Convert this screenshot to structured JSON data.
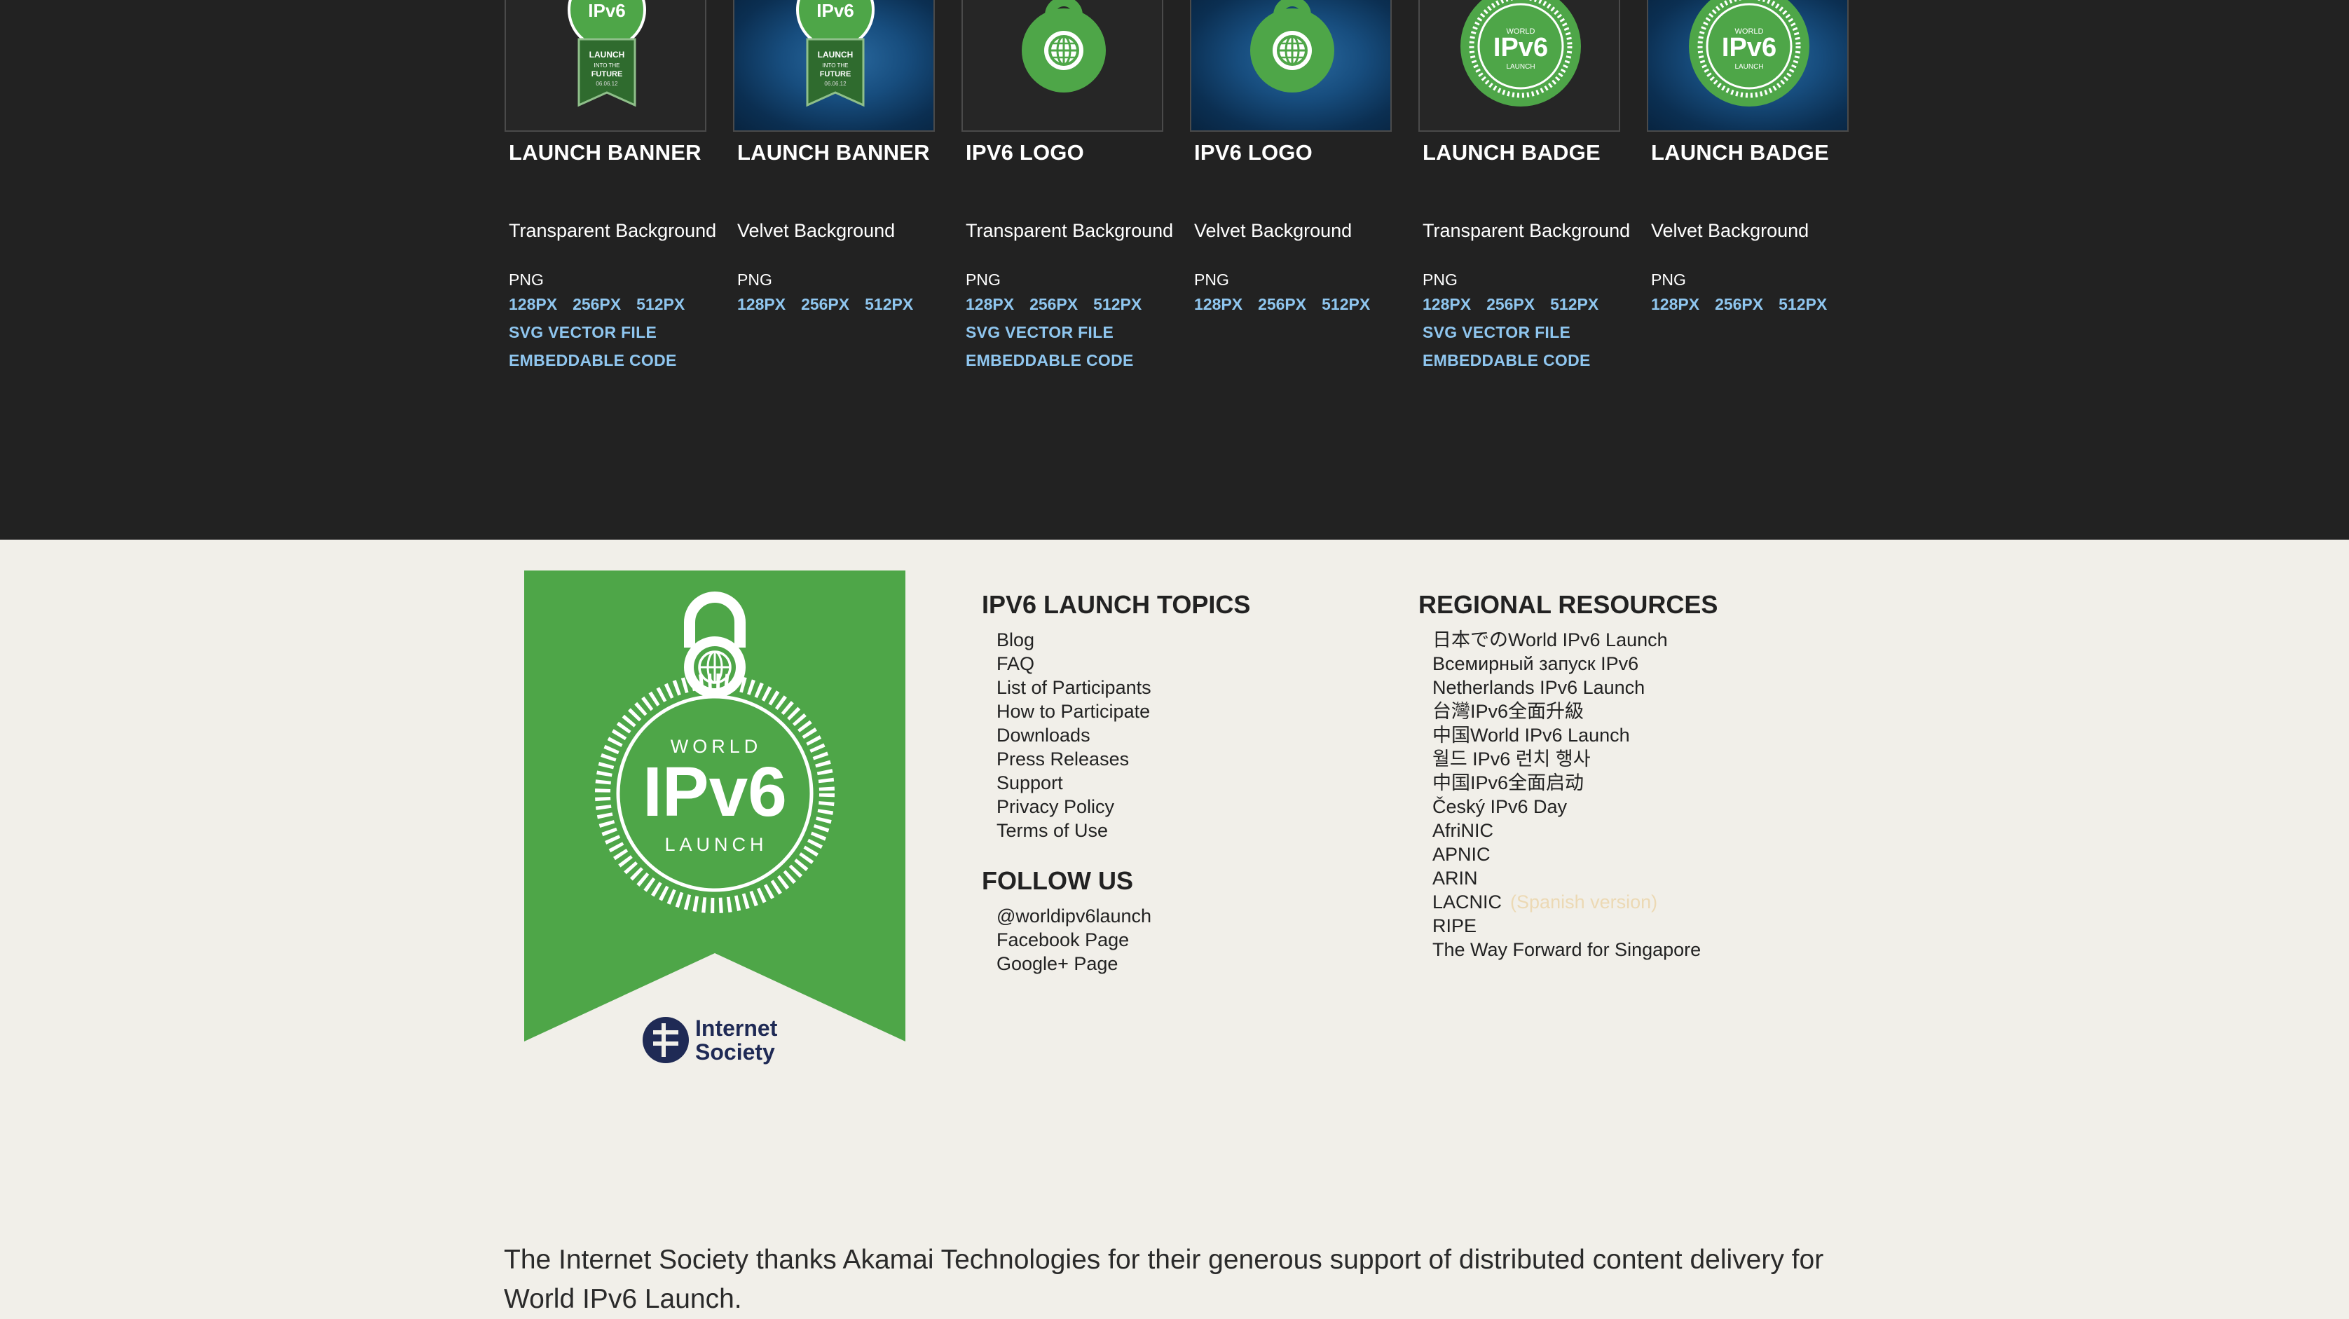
{
  "cards": [
    {
      "title": "LAUNCH BANNER",
      "background": "Transparent Background",
      "format": "PNG",
      "sizes": [
        "128PX",
        "256PX",
        "512PX"
      ],
      "svg_label": "SVG VECTOR FILE",
      "embed_label": "EMBEDDABLE CODE",
      "icon": "launch-banner-icon",
      "thumb_style": "transparent"
    },
    {
      "title": "LAUNCH BANNER",
      "background": "Velvet Background",
      "format": "PNG",
      "sizes": [
        "128PX",
        "256PX",
        "512PX"
      ],
      "icon": "launch-banner-icon",
      "thumb_style": "velvet"
    },
    {
      "title": "IPV6 LOGO",
      "background": "Transparent Background",
      "format": "PNG",
      "sizes": [
        "128PX",
        "256PX",
        "512PX"
      ],
      "svg_label": "SVG VECTOR FILE",
      "embed_label": "EMBEDDABLE CODE",
      "icon": "ipv6-logo-icon",
      "thumb_style": "transparent"
    },
    {
      "title": "IPV6 LOGO",
      "background": "Velvet Background",
      "format": "PNG",
      "sizes": [
        "128PX",
        "256PX",
        "512PX"
      ],
      "icon": "ipv6-logo-icon",
      "thumb_style": "velvet"
    },
    {
      "title": "LAUNCH BADGE",
      "background": "Transparent Background",
      "format": "PNG",
      "sizes": [
        "128PX",
        "256PX",
        "512PX"
      ],
      "svg_label": "SVG VECTOR FILE",
      "embed_label": "EMBEDDABLE CODE",
      "icon": "launch-badge-icon",
      "thumb_style": "transparent"
    },
    {
      "title": "LAUNCH BADGE",
      "background": "Velvet Background",
      "format": "PNG",
      "sizes": [
        "128PX",
        "256PX",
        "512PX"
      ],
      "icon": "launch-badge-icon",
      "thumb_style": "velvet"
    }
  ],
  "thumb_text": {
    "badge_top": "IPv6",
    "banner_line1": "LAUNCH",
    "banner_line2": "INTO THE",
    "banner_line3": "FUTURE",
    "banner_line4": "06.06.12",
    "badge_world": "WORLD",
    "badge_ipv6": "IPv6",
    "badge_launch": "LAUNCH"
  },
  "footer_logo": {
    "world": "WORLD",
    "ipv6": "IPv6",
    "launch": "LAUNCH",
    "org_line1": "Internet",
    "org_line2": "Society"
  },
  "topics": {
    "title": "IPV6 LAUNCH TOPICS",
    "items": [
      "Blog",
      "FAQ",
      "List of Participants",
      "How to Participate",
      "Downloads",
      "Press Releases",
      "Support",
      "Privacy Policy",
      "Terms of Use"
    ]
  },
  "follow": {
    "title": "FOLLOW US",
    "items": [
      "@worldipv6launch",
      "Facebook Page",
      "Google+ Page"
    ]
  },
  "regional": {
    "title": "REGIONAL RESOURCES",
    "items": [
      "日本でのWorld IPv6 Launch",
      "Всемирный запуск IPv6",
      "Netherlands IPv6 Launch",
      "台灣IPv6全面升級",
      "中国World IPv6 Launch",
      "월드 IPv6 런치 행사",
      "中国IPv6全面启动",
      "Český IPv6 Day",
      "AfriNIC",
      "APNIC",
      "ARIN",
      "LACNIC",
      "RIPE",
      "The Way Forward for Singapore"
    ],
    "lacnic_extra": "(Spanish version)"
  },
  "thanks": "The Internet Society thanks Akamai Technologies for their generous support of distributed content delivery for World IPv6 Launch.",
  "colors": {
    "dark_bg": "#222222",
    "footer_bg": "#f1efe9",
    "link_blue": "#8fc6ef",
    "ipv6_green": "#4ea648",
    "velvet_blue": "#174d7e"
  }
}
